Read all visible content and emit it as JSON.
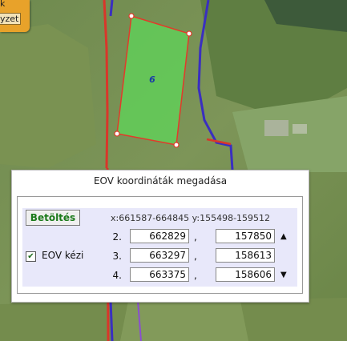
{
  "map": {
    "parcel_label": "6",
    "parcel_color": "#5fd65a",
    "road_red": "#d9362a",
    "road_blue": "#3a2fc0"
  },
  "corner_tab": {
    "line1": "k",
    "line2": "yzet"
  },
  "dialog": {
    "title": "EOV koordináták megadása",
    "load_button": "Betöltés",
    "range_text": "x:661587-664845 y:155498-159512",
    "eov_label": "EOV kézi",
    "eov_checked": true,
    "rows": [
      {
        "num": "2.",
        "x": "662829",
        "sep": ",",
        "y": "157850"
      },
      {
        "num": "3.",
        "x": "663297",
        "sep": ",",
        "y": "158613"
      },
      {
        "num": "4.",
        "x": "663375",
        "sep": ",",
        "y": "158606"
      }
    ],
    "up_arrow": "▲",
    "down_arrow": "▼"
  }
}
